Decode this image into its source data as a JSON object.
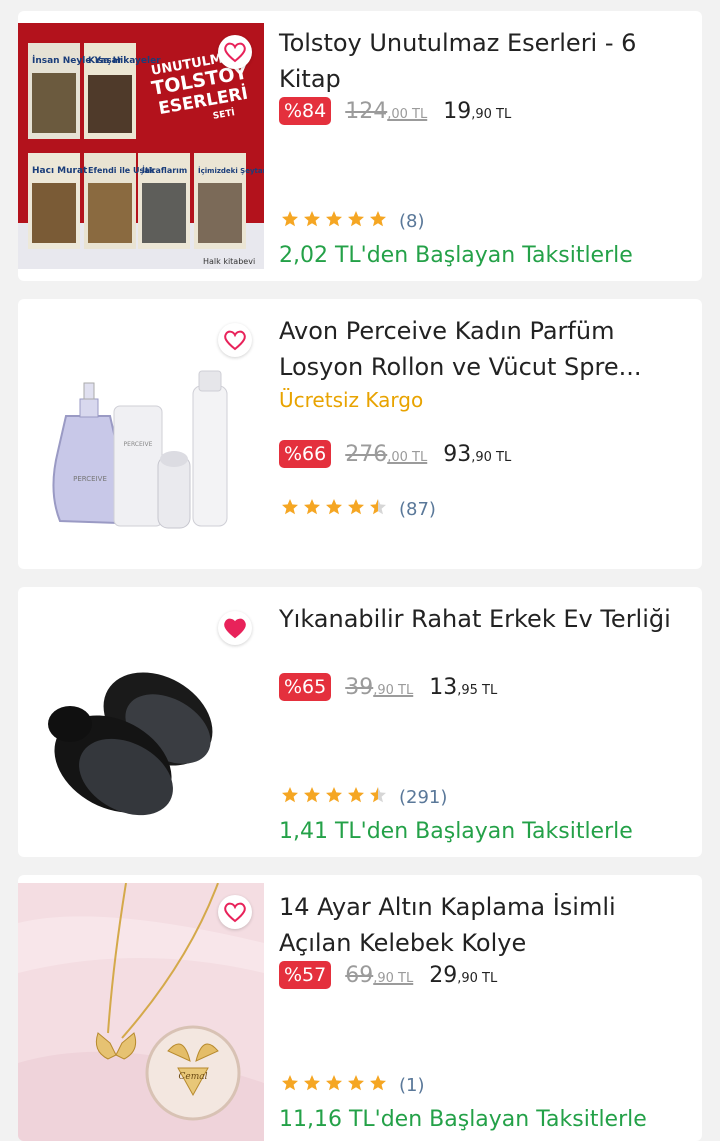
{
  "products": [
    {
      "title": "Tolstoy Unutulmaz Eserleri - 6 Kitap",
      "discount": "%84",
      "old_int": "124",
      "old_dec": ",00 TL",
      "new_int": "19",
      "new_dec": ",90 TL",
      "rating_stars": 5,
      "review_count": "(8)",
      "installment": "2,02 TL'den Başlayan Taksitlerle",
      "favorited": false,
      "image_text": {
        "banner_1": "UNUTULMAZ",
        "banner_2": "TOLSTOY",
        "banner_3": "ESERLERİ",
        "banner_4": "SETİ",
        "book_1": "İnsan Neyle Yaşar",
        "book_2": "Kısa Hikayeler",
        "book_3": "Hacı Murat",
        "book_4": "Efendi ile Uşak",
        "book_5": "İtiraflarım",
        "book_6": "İçimizdeki Şeytan",
        "publisher": "Halk kitabevi"
      }
    },
    {
      "title": "Avon Perceive Kadın Parfüm Losyon Rollon ve Vücut Spre...",
      "shipping": "Ücretsiz Kargo",
      "discount": "%66",
      "old_int": "276",
      "old_dec": ",00 TL",
      "new_int": "93",
      "new_dec": ",90 TL",
      "rating_stars": 4.5,
      "review_count": "(87)",
      "favorited": false,
      "image_text": {
        "bottle_label": "PERCEIVE",
        "tube_label": "PERCEIVE"
      }
    },
    {
      "title": "Yıkanabilir Rahat Erkek Ev Terliği",
      "discount": "%65",
      "old_int": "39",
      "old_dec": ",90 TL",
      "new_int": "13",
      "new_dec": ",95 TL",
      "rating_stars": 4.5,
      "review_count": "(291)",
      "installment": "1,41 TL'den Başlayan Taksitlerle",
      "favorited": true
    },
    {
      "title": "14 Ayar Altın Kaplama İsimli Açılan Kelebek Kolye",
      "discount": "%57",
      "old_int": "69",
      "old_dec": ",90 TL",
      "new_int": "29",
      "new_dec": ",90 TL",
      "rating_stars": 5,
      "review_count": "(1)",
      "installment": "11,16 TL'den Başlayan Taksitlerle",
      "favorited": false,
      "image_text": {
        "engraving": "Cemal"
      }
    }
  ],
  "colors": {
    "discount_bg": "#e4303d",
    "installment": "#24a148",
    "star": "#f5a623",
    "cargo": "#e8a300",
    "heart": "#e8225a"
  }
}
